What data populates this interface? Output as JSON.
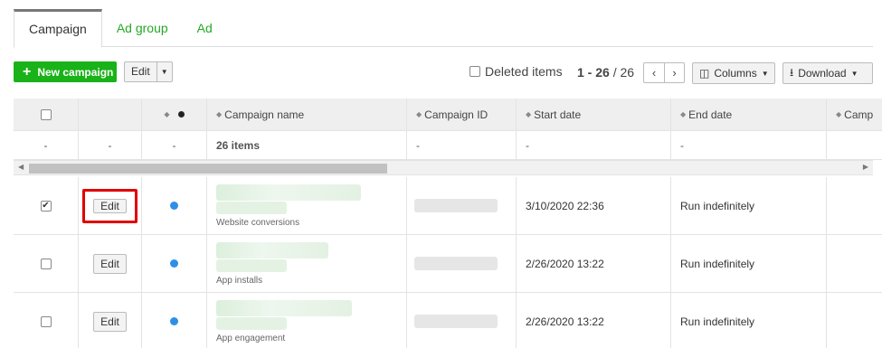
{
  "tabs": [
    "Campaign",
    "Ad group",
    "Ad"
  ],
  "toolbar": {
    "new_campaign": "New campaign",
    "edit": "Edit",
    "deleted_items": "Deleted items",
    "page_range": "1 - 26",
    "page_sep": "/",
    "page_total": "26",
    "columns": "Columns",
    "download": "Download"
  },
  "table": {
    "headers": [
      "",
      "",
      "",
      "Campaign name",
      "Campaign ID",
      "Start date",
      "End date",
      "Camp"
    ],
    "summary": [
      "-",
      "-",
      "-",
      "26 items",
      "-",
      "-",
      "-",
      ""
    ],
    "rows": [
      {
        "checked": true,
        "edit": "Edit",
        "type": "Website conversions",
        "start": "3/10/2020 22:36",
        "end": "Run indefinitely"
      },
      {
        "checked": false,
        "edit": "Edit",
        "type": "App installs",
        "start": "2/26/2020 13:22",
        "end": "Run indefinitely"
      },
      {
        "checked": false,
        "edit": "Edit",
        "type": "App engagement",
        "start": "2/26/2020 13:22",
        "end": "Run indefinitely"
      }
    ]
  },
  "colors": {
    "accent": "#19b219",
    "highlight": "#e00000",
    "status_dot": "#2f8fe6"
  }
}
